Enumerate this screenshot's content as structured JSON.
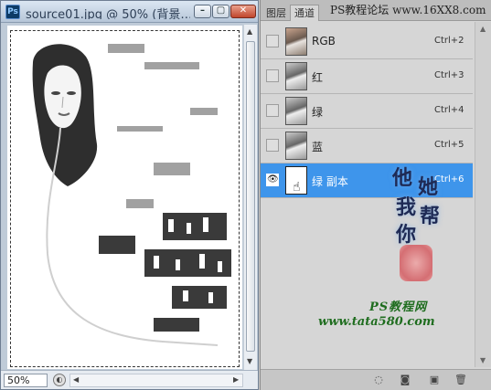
{
  "document": {
    "app_logo": "Ps",
    "title": "source01.jpg @ 50% (背景…",
    "minimize_label": "–",
    "maximize_label": "▢",
    "close_label": "✕",
    "zoom": "50%",
    "canvas_image": "grayscale high-key portrait of a woman (green channel copy)"
  },
  "panel": {
    "tabs": [
      {
        "label": "图层"
      },
      {
        "label": "通道"
      }
    ],
    "banner": "PS教程论坛 www.16XX8.com",
    "channels": [
      {
        "name": "RGB",
        "shortcut": "Ctrl+2",
        "visible": false,
        "selected": false
      },
      {
        "name": "红",
        "shortcut": "Ctrl+3",
        "visible": false,
        "selected": false
      },
      {
        "name": "绿",
        "shortcut": "Ctrl+4",
        "visible": false,
        "selected": false
      },
      {
        "name": "蓝",
        "shortcut": "Ctrl+5",
        "visible": false,
        "selected": false
      },
      {
        "name": "绿 副本",
        "shortcut": "Ctrl+6",
        "visible": true,
        "selected": true
      }
    ],
    "eye_glyph": "👁",
    "footer_icons": [
      "dotted-circle-icon",
      "mask-icon",
      "new-channel-icon",
      "trash-icon"
    ]
  },
  "watermark": {
    "calligraphy": [
      "他",
      "她",
      "我",
      "帮",
      "你"
    ],
    "brand": "PS教程网",
    "url": "www.tata580.com"
  },
  "colors": {
    "selection_blue": "#3e95eb",
    "brand_green": "#1f6d1f",
    "seal_red": "#d4545a"
  }
}
